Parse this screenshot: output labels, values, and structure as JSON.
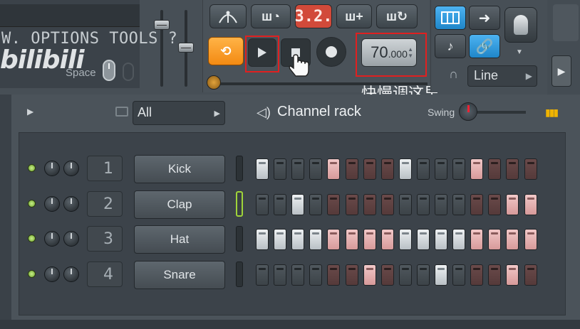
{
  "menu": {
    "text": "W. OPTIONS  TOOLS  ?",
    "watermark": "bilibili",
    "space_label": "Space"
  },
  "transport": {
    "pattern_display": "3.2.",
    "tempo_main": "70",
    "tempo_decimal": ".000",
    "tempo_note": "快慢调这里"
  },
  "tools": {
    "snap_select": "Line"
  },
  "channel_rack": {
    "filter": "All",
    "title": "Channel rack",
    "swing_label": "Swing",
    "channels": [
      {
        "number": "1",
        "name": "Kick",
        "selected": false,
        "steps": [
          "w",
          "d",
          "d",
          "d",
          "p",
          "r",
          "r",
          "r",
          "w",
          "d",
          "d",
          "d",
          "p",
          "r",
          "r",
          "r"
        ]
      },
      {
        "number": "2",
        "name": "Clap",
        "selected": true,
        "steps": [
          "d",
          "d",
          "w",
          "d",
          "r",
          "r",
          "r",
          "r",
          "d",
          "d",
          "d",
          "d",
          "r",
          "r",
          "p",
          "p"
        ]
      },
      {
        "number": "3",
        "name": "Hat",
        "selected": false,
        "steps": [
          "w",
          "w",
          "w",
          "w",
          "p",
          "p",
          "p",
          "p",
          "w",
          "w",
          "w",
          "w",
          "p",
          "p",
          "p",
          "p"
        ]
      },
      {
        "number": "4",
        "name": "Snare",
        "selected": false,
        "steps": [
          "d",
          "d",
          "d",
          "d",
          "r",
          "r",
          "p",
          "r",
          "d",
          "d",
          "w",
          "d",
          "r",
          "r",
          "p",
          "r"
        ]
      }
    ]
  },
  "icons": [
    "metronome-icon",
    "step-record-icon",
    "typing-keyboard-icon",
    "loop-icon",
    "play-icon",
    "stop-icon",
    "record-icon",
    "piano-roll-icon",
    "arrow-right-icon",
    "mixer-knob-icon",
    "link-icon",
    "magnet-icon",
    "folder-icon",
    "speaker-icon",
    "mouse-icon",
    "hand-cursor-icon"
  ]
}
